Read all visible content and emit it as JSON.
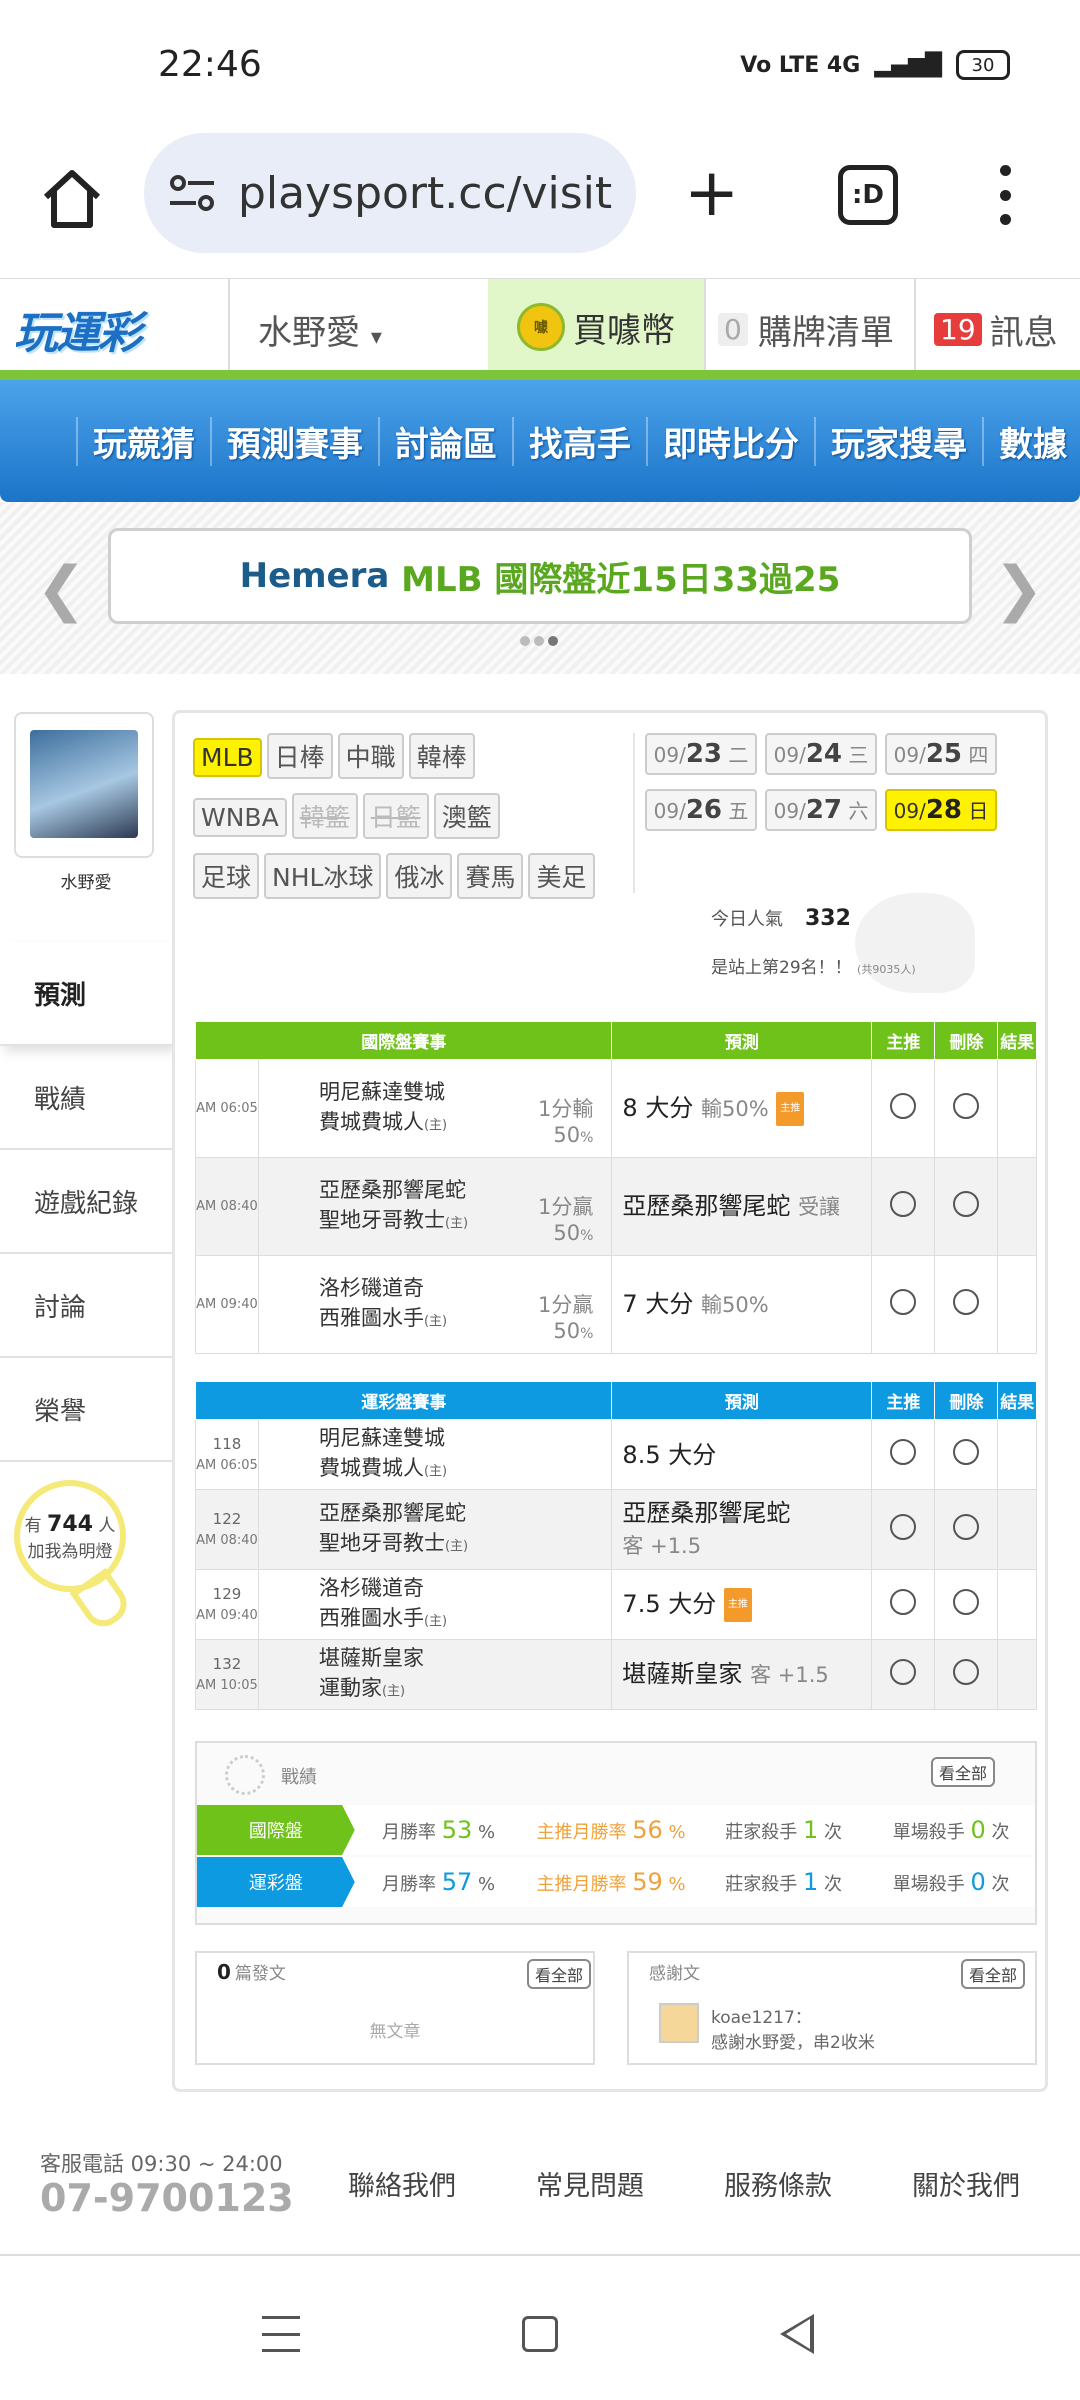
{
  "status_bar": {
    "time": "22:46",
    "signal": "Vo LTE 4G",
    "battery": "30"
  },
  "browser": {
    "url": "playsport.cc/visit",
    "tabs_label": ":D"
  },
  "header": {
    "logo": "玩運彩",
    "username": "水野愛",
    "buy_coin": "買噱幣",
    "coin_icon_text": "噱",
    "cart_count": "0",
    "cart_label": "購牌清單",
    "msg_count": "19",
    "msg_label": "訊息"
  },
  "nav": {
    "items": [
      "玩競猜",
      "預測賽事",
      "討論區",
      "找高手",
      "即時比分",
      "玩家搜尋",
      "數據"
    ]
  },
  "banner": {
    "part1": "Hemera",
    "part2": "MLB 國際盤近15日33過25"
  },
  "sidebar": {
    "name": "水野愛",
    "menu": [
      "預測",
      "戰績",
      "遊戲紀錄",
      "討論",
      "榮譽"
    ],
    "bulb_pre": "有",
    "bulb_count": "744",
    "bulb_unit": "人",
    "bulb_text": "加我為明燈"
  },
  "filters": {
    "row1": [
      "MLB",
      "日棒",
      "中職",
      "韓棒"
    ],
    "row2": [
      "WNBA",
      "韓籃",
      "日籃",
      "澳籃"
    ],
    "row3": [
      "足球",
      "NHL冰球",
      "俄冰",
      "賽馬",
      "美足"
    ]
  },
  "dates": [
    {
      "md": "09/",
      "d": "23",
      "w": "二"
    },
    {
      "md": "09/",
      "d": "24",
      "w": "三"
    },
    {
      "md": "09/",
      "d": "25",
      "w": "四"
    },
    {
      "md": "09/",
      "d": "26",
      "w": "五"
    },
    {
      "md": "09/",
      "d": "27",
      "w": "六"
    },
    {
      "md": "09/",
      "d": "28",
      "w": "日"
    }
  ],
  "popularity": {
    "label": "今日人氣",
    "value": "332",
    "rank": "是站上第29名！！",
    "total": "(共9035人)"
  },
  "intl_table": {
    "headers": [
      "國際盤賽事",
      "預測",
      "主推",
      "刪除",
      "結果"
    ],
    "rows": [
      {
        "time": "AM 06:05",
        "away": "明尼蘇達雙城",
        "home": "費城費城人",
        "home_tag": "(主)",
        "line1": "1分輸",
        "line2": "50",
        "pct": "%",
        "pred": "8 大分",
        "pred_sub": "輸50%",
        "tag": "主推"
      },
      {
        "time": "AM 08:40",
        "away": "亞歷桑那響尾蛇",
        "home": "聖地牙哥教士",
        "home_tag": "(主)",
        "line1": "1分贏",
        "line2": "50",
        "pct": "%",
        "pred": "亞歷桑那響尾蛇",
        "pred_sub": "受讓"
      },
      {
        "time": "AM 09:40",
        "away": "洛杉磯道奇",
        "home": "西雅圖水手",
        "home_tag": "(主)",
        "line1": "1分贏",
        "line2": "50",
        "pct": "%",
        "pred": "7 大分",
        "pred_sub": "輸50%"
      }
    ]
  },
  "sports_table": {
    "headers": [
      "運彩盤賽事",
      "預測",
      "主推",
      "刪除",
      "結果"
    ],
    "rows": [
      {
        "num": "118",
        "time": "AM 06:05",
        "away": "明尼蘇達雙城",
        "home": "費城費城人",
        "home_tag": "(主)",
        "pred": "8.5 大分"
      },
      {
        "num": "122",
        "time": "AM 08:40",
        "away": "亞歷桑那響尾蛇",
        "home": "聖地牙哥教士",
        "home_tag": "(主)",
        "pred": "亞歷桑那響尾蛇",
        "pred_sub": "客 +1.5"
      },
      {
        "num": "129",
        "time": "AM 09:40",
        "away": "洛杉磯道奇",
        "home": "西雅圖水手",
        "home_tag": "(主)",
        "pred": "7.5 大分",
        "tag": "主推"
      },
      {
        "num": "132",
        "time": "AM 10:05",
        "away": "堪薩斯皇家",
        "home": "運動家",
        "home_tag": "(主)",
        "pred": "堪薩斯皇家",
        "pred_sub": "客 +1.5"
      }
    ]
  },
  "stats": {
    "title": "戰績",
    "see_all": "看全部",
    "intl": {
      "label": "國際盤",
      "month_label": "月勝率",
      "month": "53",
      "main_label": "主推月勝率",
      "main": "56",
      "bank_label": "莊家殺手",
      "bank": "1",
      "single_label": "單場殺手",
      "single": "0",
      "pct": "%",
      "times": "次"
    },
    "sports": {
      "label": "運彩盤",
      "month_label": "月勝率",
      "month": "57",
      "main_label": "主推月勝率",
      "main": "59",
      "bank_label": "莊家殺手",
      "bank": "1",
      "single_label": "單場殺手",
      "single": "0",
      "pct": "%",
      "times": "次"
    }
  },
  "posts": {
    "count": "0",
    "label": "篇發文",
    "see_all": "看全部",
    "empty": "無文章"
  },
  "thanks": {
    "label": "感謝文",
    "see_all": "看全部",
    "user": "koae1217：",
    "text": "感謝水野愛，串2收米"
  },
  "footer": {
    "service": "客服電話 09:30 ~ 24:00",
    "phone": "07-9700123",
    "links": [
      "聯絡我們",
      "常見問題",
      "服務條款",
      "關於我們"
    ]
  },
  "colors": {
    "green": "#6fc21a",
    "blue": "#0d9ae0",
    "nav_blue": "#1c74c9",
    "highlight": "#fff200"
  }
}
